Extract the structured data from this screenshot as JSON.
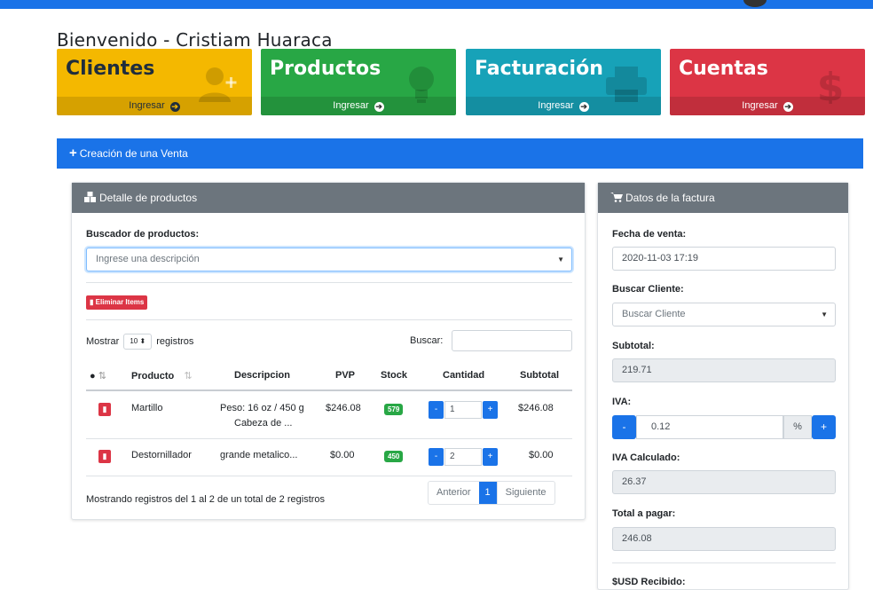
{
  "welcome": {
    "prefix": "Bienvenido - Cristiam",
    "last": "Huaraca"
  },
  "tiles": [
    {
      "title": "Clientes",
      "link": "Ingresar",
      "icon": "user-plus-icon"
    },
    {
      "title": "Productos",
      "link": "Ingresar",
      "icon": "lightbulb-icon"
    },
    {
      "title": "Facturación",
      "link": "Ingresar",
      "icon": "printer-icon"
    },
    {
      "title": "Cuentas",
      "link": "Ingresar",
      "icon": "dollar-icon"
    }
  ],
  "venta": {
    "title": "Creación de una Venta"
  },
  "detalle": {
    "title": "Detalle de productos",
    "search_label": "Buscador de productos:",
    "search_placeholder": "Ingrese una descripción",
    "delete_button": "Eliminar Items",
    "show_prefix": "Mostrar",
    "show_value": "10",
    "show_suffix": "registros",
    "search_table_label": "Buscar:",
    "columns": [
      "Producto",
      "Descripcion",
      "PVP",
      "Stock",
      "Cantidad",
      "Subtotal"
    ],
    "rows": [
      {
        "producto": "Martillo",
        "desc1": "Peso: 16 oz / 450 g",
        "desc2": "Cabeza de ...",
        "pvp": "$246.08",
        "stock": "579",
        "cantidad": "1",
        "subtotal": "$246.08"
      },
      {
        "producto": "Destornillador",
        "desc1": "grande metalico...",
        "desc2": "",
        "pvp": "$0.00",
        "stock": "450",
        "cantidad": "2",
        "subtotal": "$0.00"
      }
    ],
    "footer_info": "Mostrando registros del 1 al 2 de un total de 2 registros",
    "pager": {
      "prev": "Anterior",
      "current": "1",
      "next": "Siguiente"
    }
  },
  "factura": {
    "title": "Datos de la factura",
    "fecha_label": "Fecha de venta:",
    "fecha_value": "2020-11-03 17:19",
    "cliente_label": "Buscar Cliente:",
    "cliente_placeholder": "Buscar Cliente",
    "subtotal_label": "Subtotal:",
    "subtotal_value": "219.71",
    "iva_label": "IVA:",
    "iva_value": "0.12",
    "iva_unit": "%",
    "iva_calc_label": "IVA Calculado:",
    "iva_calc_value": "26.37",
    "total_label": "Total a pagar:",
    "total_value": "246.08",
    "recibido_label": "$USD Recibido:"
  },
  "colors": {
    "primary": "#1a73e8",
    "yellow": "#f4b800",
    "green": "#28a745",
    "teal": "#17a2b8",
    "red": "#dc3545",
    "gray_head": "#6c757d"
  }
}
